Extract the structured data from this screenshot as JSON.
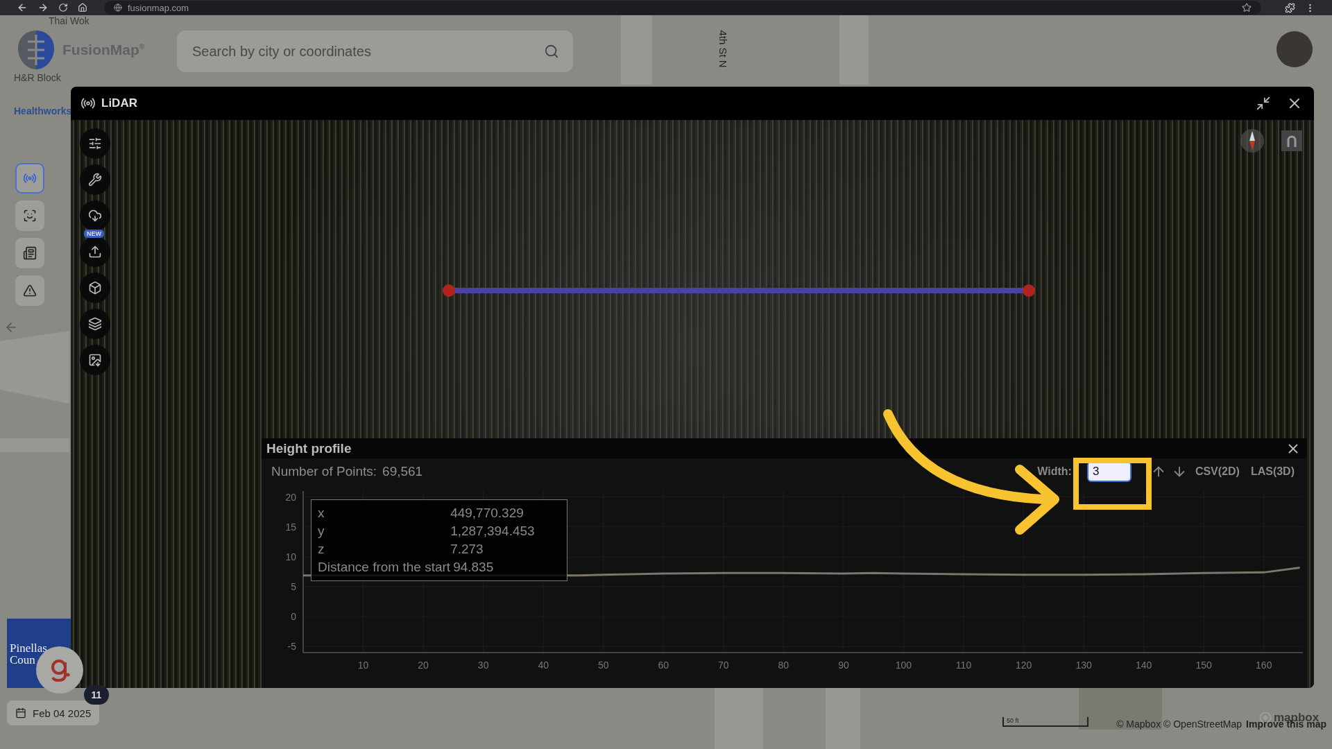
{
  "browser": {
    "url": "fusionmap.com"
  },
  "map_labels": [
    {
      "text": "Thai Wok",
      "kind": "place"
    },
    {
      "text": "H&R Block",
      "kind": "place"
    },
    {
      "text": "Healthworks",
      "kind": "poi"
    },
    {
      "text": "4th St N",
      "kind": "street"
    }
  ],
  "logo": {
    "name": "FusionMap",
    "mark": "®"
  },
  "search": {
    "placeholder": "Search by city or coordinates"
  },
  "sidebar": {
    "items": [
      {
        "selected": true
      },
      {
        "selected": false
      },
      {
        "selected": false
      },
      {
        "selected": false
      }
    ]
  },
  "lidar_window": {
    "title": "LiDAR",
    "new_badge": "NEW",
    "tools": [
      {
        "has_badge": false
      },
      {
        "has_badge": false
      },
      {
        "has_badge": false
      },
      {
        "has_badge": true
      },
      {
        "has_badge": false
      },
      {
        "has_badge": false
      },
      {
        "has_badge": false
      }
    ]
  },
  "height_profile": {
    "title": "Height profile",
    "points_label": "Number of Points:",
    "points_value": "69,561",
    "width_label": "Width:",
    "width_value": "3",
    "export_buttons": [
      "CSV(2D)",
      "LAS(3D)"
    ],
    "tooltip": [
      {
        "label": "x",
        "value": "449,770.329"
      },
      {
        "label": "y",
        "value": "1,287,394.453"
      },
      {
        "label": "z",
        "value": "7.273"
      },
      {
        "label": "Distance from the start",
        "value": "94.835"
      }
    ],
    "chart_data": {
      "type": "line",
      "grid": true,
      "xlim": [
        0,
        166.5
      ],
      "ylim": [
        -6,
        21
      ],
      "xticks": [
        10,
        20,
        30,
        40,
        50,
        60,
        70,
        80,
        90,
        100,
        110,
        120,
        130,
        140,
        150,
        160
      ],
      "yticks": [
        -5,
        0,
        5,
        10,
        15,
        20
      ],
      "x": [
        0,
        46,
        50,
        60,
        70,
        80,
        90,
        95,
        100,
        110,
        120,
        130,
        140,
        150,
        160,
        166
      ],
      "series": [
        {
          "color": "#7d766b",
          "values": [
            6.9,
            6.9,
            7.0,
            7.2,
            7.3,
            7.3,
            7.2,
            7.3,
            7.2,
            7.1,
            7.0,
            7.0,
            7.1,
            7.3,
            7.4,
            8.2
          ]
        }
      ]
    }
  },
  "pinellas": "Pinellas Coun",
  "notification": {
    "count": "11"
  },
  "date": "Feb 04 2025",
  "scale": "50 ft",
  "mapbox_logo": "mapbox",
  "attribution": {
    "text": "© Mapbox © OpenStreetMap",
    "link": "Improve this map"
  }
}
